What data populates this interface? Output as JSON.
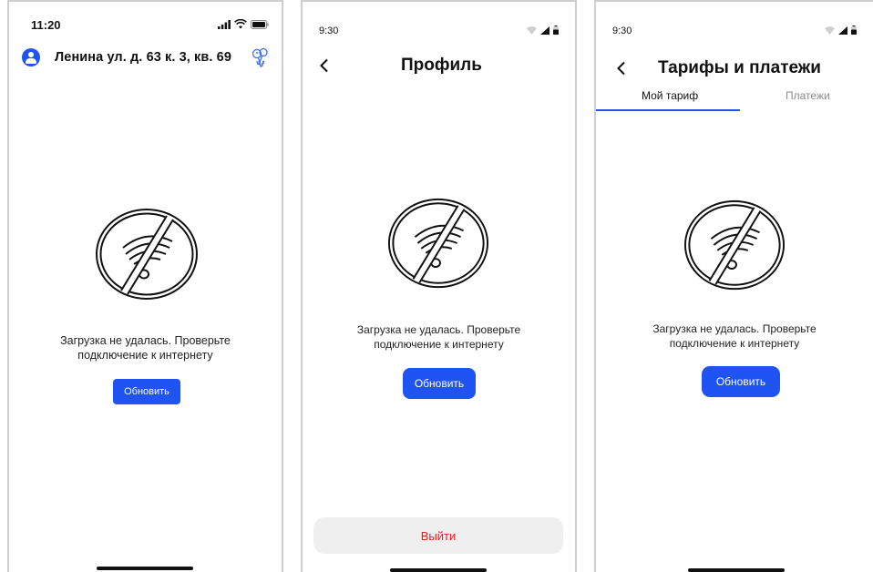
{
  "colors": {
    "accent": "#1f53f2",
    "danger": "#e02020",
    "logout_bg": "#efefef"
  },
  "screens": [
    {
      "status_time": "11:20",
      "address": "Ленина ул. д. 63 к. 3, кв. 69",
      "error_line1": "Загрузка не удалась. Проверьте",
      "error_line2": "подключение к интернету",
      "refresh_label": "Обновить"
    },
    {
      "status_time": "9:30",
      "title": "Профиль",
      "error_line1": "Загрузка не удалась. Проверьте",
      "error_line2": "подключение к интернету",
      "refresh_label": "Обновить",
      "logout_label": "Выйти"
    },
    {
      "status_time": "9:30",
      "title": "Тарифы и платежи",
      "tabs": [
        "Мой тариф",
        "Платежи"
      ],
      "active_tab": "Мой тариф",
      "error_line1": "Загрузка не удалась. Проверьте",
      "error_line2": "подключение к интернету",
      "refresh_label": "Обновить"
    }
  ]
}
